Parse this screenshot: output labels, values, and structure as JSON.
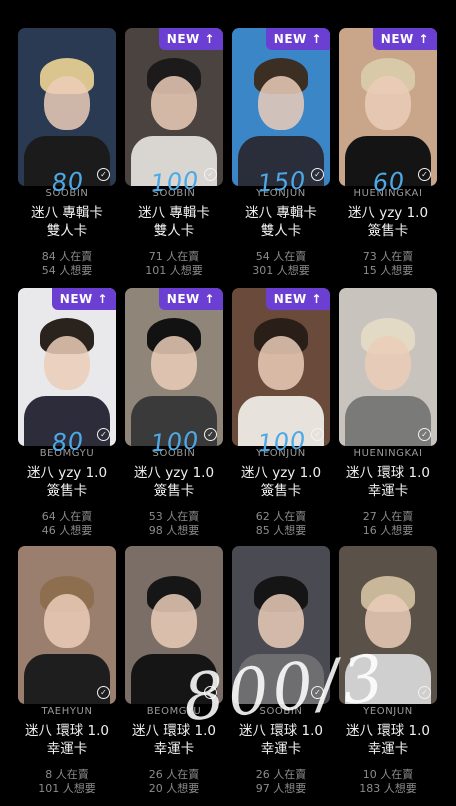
{
  "cards": [
    {
      "member": "SOOBIN",
      "title_line1": "迷八 專輯卡",
      "title_line2": "雙人卡",
      "selling": "84 人在賣",
      "wanting": "54 人想要",
      "price": "80",
      "new": false,
      "photo": {
        "bg": "#2a3a52",
        "hair": "#d9c58d",
        "body": "#1b1b1b"
      }
    },
    {
      "member": "SOOBIN",
      "title_line1": "迷八 專輯卡",
      "title_line2": "雙人卡",
      "selling": "71 人在賣",
      "wanting": "101 人想要",
      "price": "100",
      "new": true,
      "photo": {
        "bg": "#4a4340",
        "hair": "#1c1a1a",
        "body": "#d9d6d2"
      }
    },
    {
      "member": "YEONJUN",
      "title_line1": "迷八 專輯卡",
      "title_line2": "雙人卡",
      "selling": "54 人在賣",
      "wanting": "301 人想要",
      "price": "150",
      "new": true,
      "photo": {
        "bg": "#3a86c7",
        "hair": "#3b2e23",
        "body": "#2a2d3a"
      }
    },
    {
      "member": "HUENINGKAI",
      "title_line1": "迷八 yzy 1.0",
      "title_line2": "簽售卡",
      "selling": "73 人在賣",
      "wanting": "15 人想要",
      "price": "60",
      "new": true,
      "photo": {
        "bg": "#c9a68a",
        "hair": "#d8c9a8",
        "body": "#141414"
      }
    },
    {
      "member": "BEOMGYU",
      "title_line1": "迷八 yzy 1.0",
      "title_line2": "簽售卡",
      "selling": "64 人在賣",
      "wanting": "46 人想要",
      "price": "80",
      "new": true,
      "photo": {
        "bg": "#e9e9ec",
        "hair": "#2a221d",
        "body": "#2c2c3a"
      }
    },
    {
      "member": "SOOBIN",
      "title_line1": "迷八 yzy 1.0",
      "title_line2": "簽售卡",
      "selling": "53 人在賣",
      "wanting": "98 人想要",
      "price": "100",
      "new": true,
      "photo": {
        "bg": "#8f8578",
        "hair": "#121212",
        "body": "#3a3a3a"
      }
    },
    {
      "member": "YEONJUN",
      "title_line1": "迷八 yzy 1.0",
      "title_line2": "簽售卡",
      "selling": "62 人在賣",
      "wanting": "85 人想要",
      "price": "100",
      "new": true,
      "photo": {
        "bg": "#6a4a3a",
        "hair": "#2a1e19",
        "body": "#e8e2dc"
      }
    },
    {
      "member": "HUENINGKAI",
      "title_line1": "迷八 環球 1.0",
      "title_line2": "幸運卡",
      "selling": "27 人在賣",
      "wanting": "16 人想要",
      "price": "",
      "new": false,
      "photo": {
        "bg": "#c8c3bd",
        "hair": "#e3dac6",
        "body": "#7a7a78"
      }
    },
    {
      "member": "TAEHYUN",
      "title_line1": "迷八 環球 1.0",
      "title_line2": "幸運卡",
      "selling": "8 人在賣",
      "wanting": "101 人想要",
      "price": "",
      "new": false,
      "photo": {
        "bg": "#9a7f6e",
        "hair": "#8d6e4f",
        "body": "#1e1e1e"
      }
    },
    {
      "member": "BEOMGYU",
      "title_line1": "迷八 環球 1.0",
      "title_line2": "幸運卡",
      "selling": "26 人在賣",
      "wanting": "20 人想要",
      "price": "",
      "new": false,
      "photo": {
        "bg": "#7a6e66",
        "hair": "#161616",
        "body": "#151515"
      }
    },
    {
      "member": "SOOBIN",
      "title_line1": "迷八 環球 1.0",
      "title_line2": "幸運卡",
      "selling": "26 人在賣",
      "wanting": "97 人想要",
      "price": "",
      "new": false,
      "photo": {
        "bg": "#4a4a52",
        "hair": "#151515",
        "body": "#6e6e70"
      }
    },
    {
      "member": "YEONJUN",
      "title_line1": "迷八 環球 1.0",
      "title_line2": "幸運卡",
      "selling": "10 人在賣",
      "wanting": "183 人想要",
      "price": "",
      "new": false,
      "photo": {
        "bg": "#5a5148",
        "hair": "#c9b79a",
        "body": "#cfcfcf"
      }
    }
  ],
  "badge_label": "NEW ↑",
  "overlay_price": "800/3",
  "colors": {
    "accent": "#6c3fd3",
    "price_ink": "#4da9e6",
    "background": "#000000"
  }
}
